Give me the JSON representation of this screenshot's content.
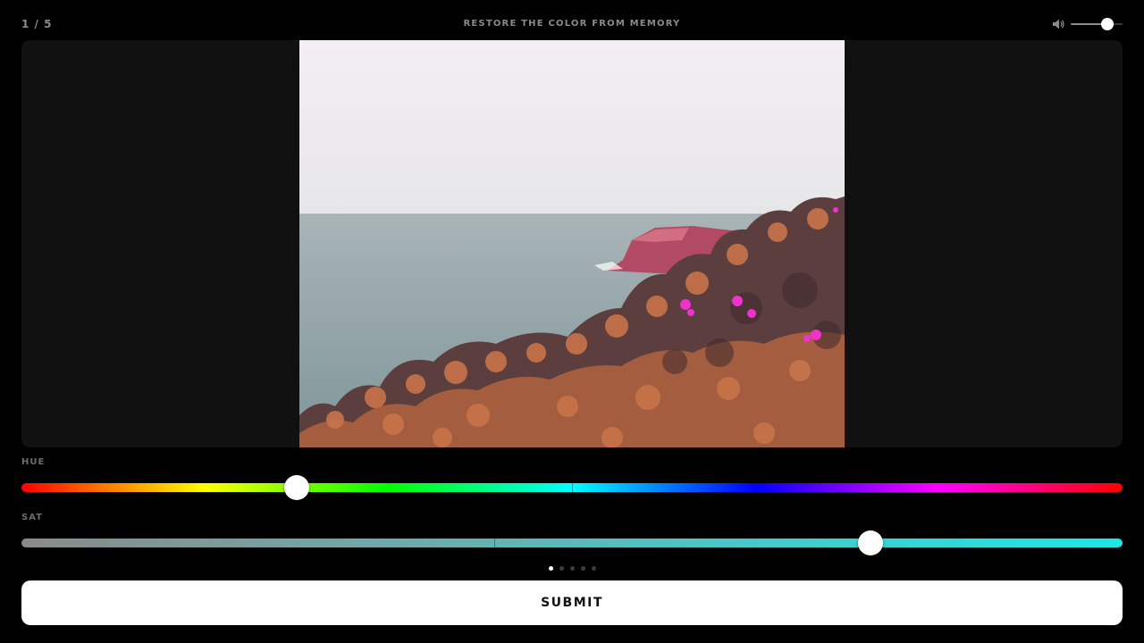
{
  "header": {
    "counter": "1 / 5",
    "title": "RESTORE THE COLOR FROM MEMORY",
    "volume_icon": "speaker-icon",
    "volume_level": 0.7
  },
  "viewer": {
    "photo": "coastal-cliff-with-flowering-shrubs",
    "palette": {
      "sky": "#ece4ec",
      "sea": "#92a5a7",
      "foliage": "#c8744a",
      "blossom": "#ee33cc"
    }
  },
  "sliders": {
    "hue": {
      "label": "HUE",
      "value": 0.25,
      "center_mark": 0.5
    },
    "sat": {
      "label": "SAT",
      "value": 0.771,
      "center_mark": 0.429
    }
  },
  "pagination": {
    "total": 5,
    "current": 1
  },
  "actions": {
    "submit_label": "SUBMIT"
  }
}
